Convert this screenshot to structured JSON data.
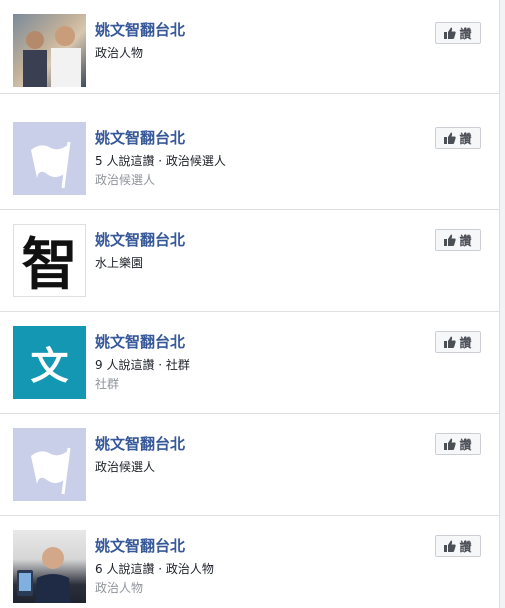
{
  "like_label": "讚",
  "pages": [
    {
      "name": "姚文智翻台北",
      "line2": "政治人物",
      "line3": "",
      "thumb": "photo-person-crowd"
    },
    {
      "name": "姚文智翻台北",
      "line2": "5 人說這讚 · 政治候選人",
      "line3": "政治候選人",
      "thumb": "flag-placeholder"
    },
    {
      "name": "姚文智翻台北",
      "line2": "水上樂園",
      "line3": "",
      "thumb": "zhi-character",
      "thumb_char": "智"
    },
    {
      "name": "姚文智翻台北",
      "line2": "9 人說這讚 · 社群",
      "line3": "社群",
      "thumb": "wen-character",
      "thumb_char": "文"
    },
    {
      "name": "姚文智翻台北",
      "line2": "政治候選人",
      "line3": "",
      "thumb": "flag-placeholder"
    },
    {
      "name": "姚文智翻台北",
      "line2": "6 人說這讚 · 政治人物",
      "line3": "政治人物",
      "thumb": "photo-person-podium"
    }
  ]
}
